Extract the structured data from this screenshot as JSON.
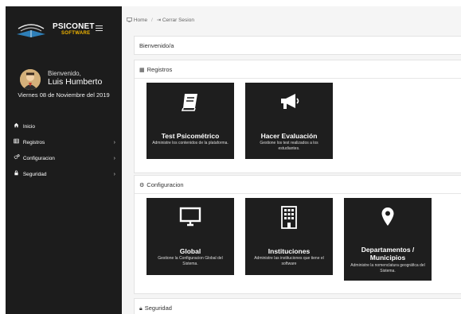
{
  "brand": {
    "title": "PSICONET",
    "subtitle": "SOFTWARE"
  },
  "user": {
    "welcome": "Bienvenido,",
    "name": "Luis Humberto",
    "date": "Viernes 08 de Noviembre del 2019"
  },
  "nav": {
    "items": [
      {
        "label": "Inicio",
        "icon": "home-icon",
        "has_children": false
      },
      {
        "label": "Registros",
        "icon": "table-icon",
        "has_children": true
      },
      {
        "label": "Configuracion",
        "icon": "cogs-icon",
        "has_children": true
      },
      {
        "label": "Seguridad",
        "icon": "lock-icon",
        "has_children": true
      }
    ]
  },
  "breadcrumb": {
    "home": "Home",
    "logout": "Cerrar Sesion"
  },
  "welcome_panel": {
    "title": "Bienvenido/a"
  },
  "registros": {
    "title": "Registros",
    "cards": [
      {
        "title": "Test Psicométrico",
        "desc": "Administre los contenidos de la plataforma.",
        "icon": "book-icon"
      },
      {
        "title": "Hacer Evaluación",
        "desc": "Gestione los test realizados a los estudiantes.",
        "icon": "megaphone-icon"
      }
    ]
  },
  "configuracion": {
    "title": "Configuracion",
    "cards": [
      {
        "title": "Global",
        "desc": "Gestione la Configuracion Global del Sistema.",
        "icon": "monitor-icon"
      },
      {
        "title": "Instituciones",
        "desc": "Administre las instituciones que tiene el software",
        "icon": "building-icon"
      },
      {
        "title": "Departamentos / Municipios",
        "desc": "Administre la nomenclatura geográfica del Sistema.",
        "icon": "map-marker-icon"
      }
    ]
  },
  "seguridad": {
    "title": "Seguridad"
  },
  "colors": {
    "sidebar": "#1c1c1c",
    "card": "#1e1e1e",
    "accent": "#f0b400"
  }
}
